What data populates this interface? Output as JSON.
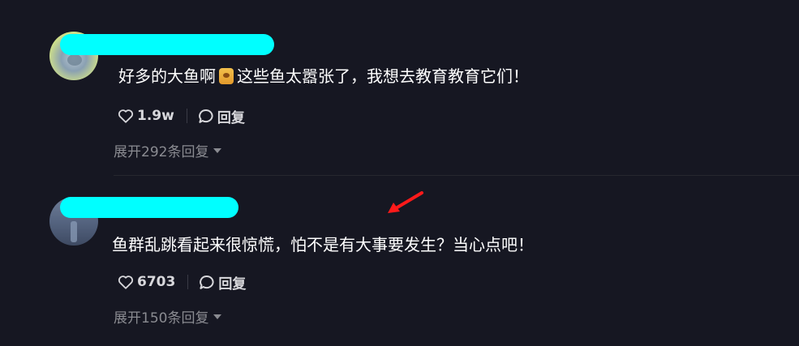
{
  "comments": [
    {
      "username": "",
      "text_before": "好多的大鱼啊",
      "sticker_icon": "fish-sticker-icon",
      "text_after": "这些鱼太嚣张了，我想去教育教育它们！",
      "likes": "1.9w",
      "reply_label": "回复",
      "expand_label": "展开292条回复"
    },
    {
      "username": "",
      "text": "鱼群乱跳看起来很惊慌，怕不是有大事要发生？当心点吧！",
      "likes": "6703",
      "reply_label": "回复",
      "expand_label": "展开150条回复"
    }
  ],
  "colors": {
    "background": "#161722",
    "redaction": "#00ffff",
    "annotation_arrow": "#ff1a1a",
    "muted_text": "#8a8b91"
  }
}
